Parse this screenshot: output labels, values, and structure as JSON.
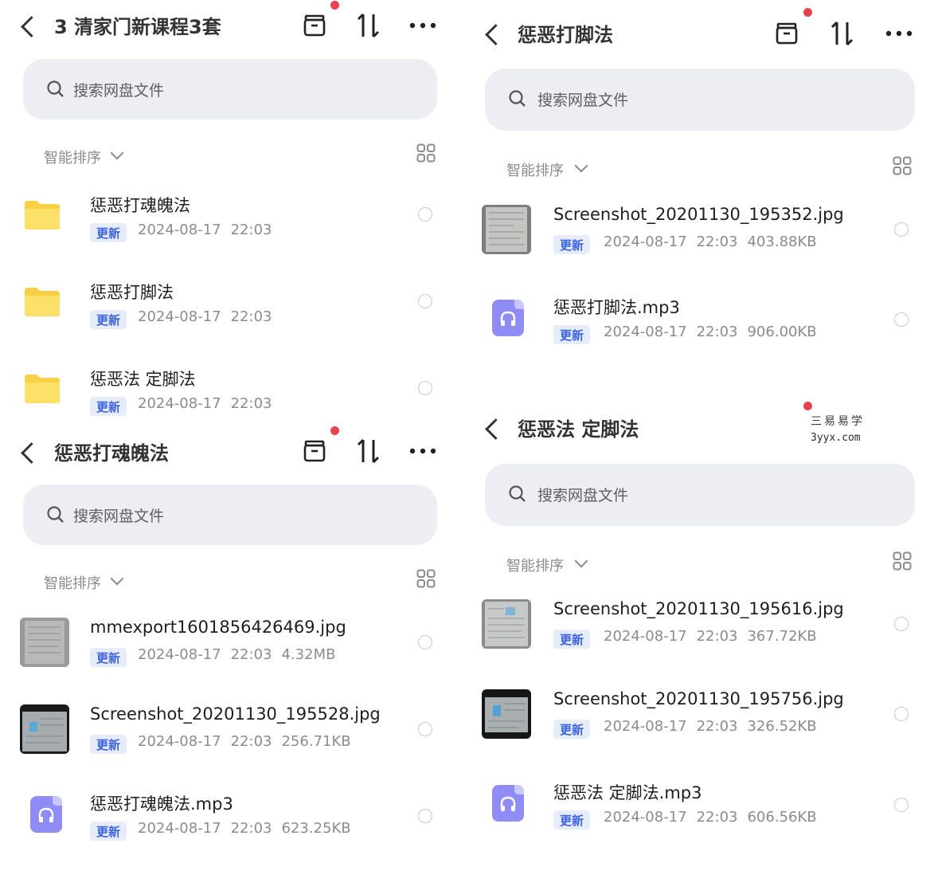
{
  "search_placeholder": "搜索网盘文件",
  "sort_label": "智能排序",
  "badge_label": "更新",
  "colors": {
    "accent": "#3d63e0",
    "badge_bg": "#e6ecfb",
    "red_dot": "#e8424f",
    "folder": "#f7d043",
    "audio": "#8f8cf5"
  },
  "panels": [
    {
      "title": "3 清家门新课程3套",
      "items": [
        {
          "type": "folder",
          "name": "惩恶打魂魄法",
          "date": "2024-08-17",
          "time": "22:03",
          "size": ""
        },
        {
          "type": "folder",
          "name": "惩恶打脚法",
          "date": "2024-08-17",
          "time": "22:03",
          "size": ""
        },
        {
          "type": "folder",
          "name": "惩恶法  定脚法",
          "date": "2024-08-17",
          "time": "22:03",
          "size": ""
        }
      ]
    },
    {
      "title": "惩恶打魂魄法",
      "items": [
        {
          "type": "image",
          "name": "mmexport1601856426469.jpg",
          "date": "2024-08-17",
          "time": "22:03",
          "size": "4.32MB"
        },
        {
          "type": "image",
          "name": "Screenshot_20201130_195528.jpg",
          "date": "2024-08-17",
          "time": "22:03",
          "size": "256.71KB"
        },
        {
          "type": "audio",
          "name": "惩恶打魂魄法.mp3",
          "date": "2024-08-17",
          "time": "22:03",
          "size": "623.25KB"
        }
      ]
    },
    {
      "title": "惩恶打脚法",
      "items": [
        {
          "type": "image",
          "name": "Screenshot_20201130_195352.jpg",
          "date": "2024-08-17",
          "time": "22:03",
          "size": "403.88KB"
        },
        {
          "type": "audio",
          "name": "惩恶打脚法.mp3",
          "date": "2024-08-17",
          "time": "22:03",
          "size": "906.00KB"
        }
      ]
    },
    {
      "title": "惩恶法  定脚法",
      "items": [
        {
          "type": "image",
          "name": "Screenshot_20201130_195616.jpg",
          "date": "2024-08-17",
          "time": "22:03",
          "size": "367.72KB"
        },
        {
          "type": "image",
          "name": "Screenshot_20201130_195756.jpg",
          "date": "2024-08-17",
          "time": "22:03",
          "size": "326.52KB"
        },
        {
          "type": "audio",
          "name": "惩恶法  定脚法.mp3",
          "date": "2024-08-17",
          "time": "22:03",
          "size": "606.56KB"
        }
      ]
    }
  ],
  "watermark": {
    "line1": "三易易学",
    "line2": "3yyx.com"
  }
}
